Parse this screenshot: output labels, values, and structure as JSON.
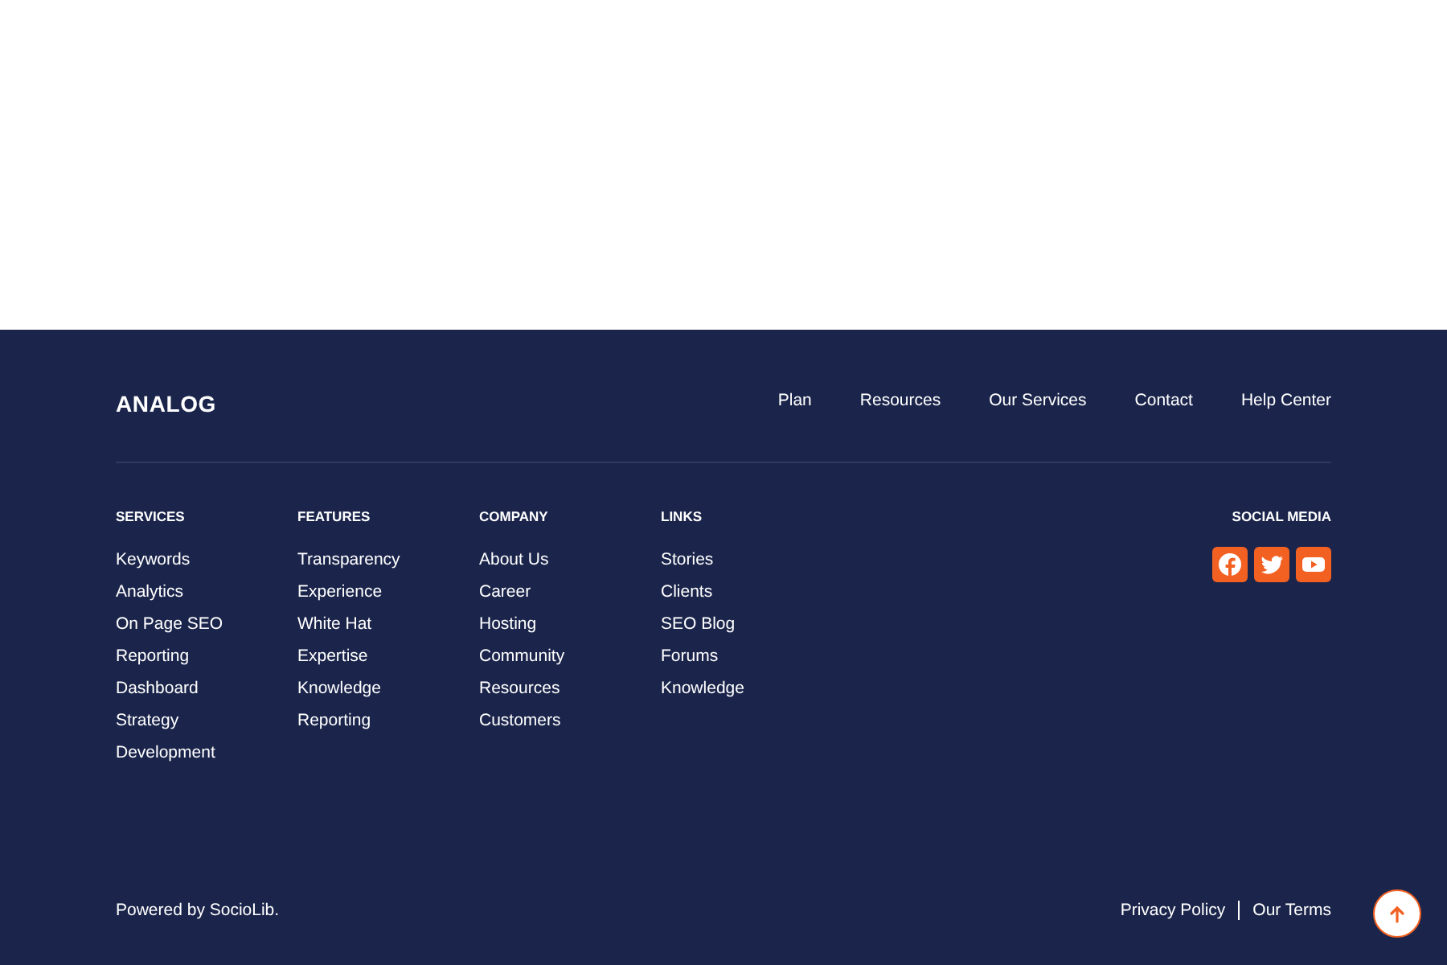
{
  "footer": {
    "logo": "ANALOG",
    "nav": [
      "Plan",
      "Resources",
      "Our Services",
      "Contact",
      "Help Center"
    ],
    "columns": [
      {
        "heading": "SERVICES",
        "items": [
          "Keywords",
          "Analytics",
          "On Page SEO",
          "Reporting",
          "Dashboard",
          "Strategy",
          "Development"
        ]
      },
      {
        "heading": "FEATURES",
        "items": [
          "Transparency",
          "Experience",
          "White Hat",
          "Expertise",
          "Knowledge",
          "Reporting"
        ]
      },
      {
        "heading": "COMPANY",
        "items": [
          "About Us",
          "Career",
          "Hosting",
          "Community",
          "Resources",
          "Customers"
        ]
      },
      {
        "heading": "LINKS",
        "items": [
          "Stories",
          "Clients",
          "SEO Blog",
          "Forums",
          "Knowledge"
        ]
      }
    ],
    "social": {
      "heading": "SOCIAL MEDIA",
      "icons": [
        {
          "kind": "facebook"
        },
        {
          "kind": "twitter"
        },
        {
          "kind": "youtube"
        }
      ]
    },
    "powered_by": "Powered by SocioLib.",
    "legal_links": [
      "Privacy Policy",
      "Our Terms"
    ]
  }
}
